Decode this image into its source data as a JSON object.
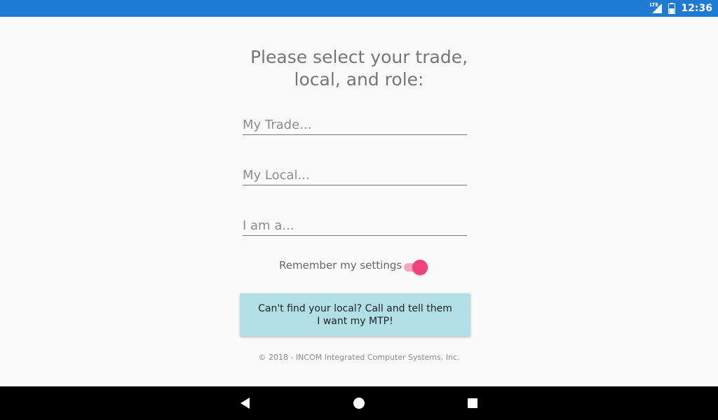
{
  "status_bar": {
    "network": "LTE",
    "time": "12:36",
    "icons": [
      "lte-signal-icon",
      "battery-icon"
    ],
    "color": "#1e7ad3"
  },
  "form": {
    "title_line1": "Please select your trade,",
    "title_line2": "local, and role:",
    "trade_placeholder": "My Trade...",
    "local_placeholder": "My Local...",
    "role_placeholder": "I am a...",
    "remember_label": "Remember my settings",
    "remember_enabled": true,
    "toggle_color": "#f0437a",
    "button_line1": "Can't find your local? Call and tell them",
    "button_line2": "I want my MTP!",
    "button_color": "#b0e0e6",
    "copyright": "© 2018 - INCOM Integrated Computer Systems, Inc."
  },
  "nav_bar": {
    "icons": [
      "back-icon",
      "home-icon",
      "recent-apps-icon"
    ]
  }
}
